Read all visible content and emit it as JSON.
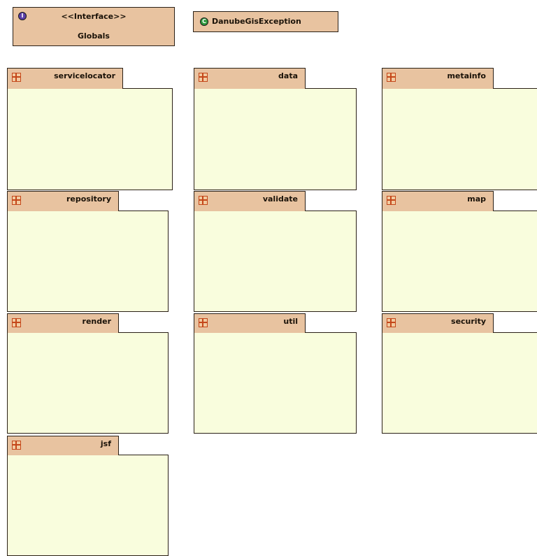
{
  "interface_class": {
    "icon": "interface-icon",
    "stereotype": "<<Interface>>",
    "name": "Globals"
  },
  "exception_class": {
    "icon": "class-icon",
    "name": "DanubeGisException"
  },
  "packages": [
    {
      "name": "servicelocator",
      "icon": "package-icon"
    },
    {
      "name": "data",
      "icon": "package-icon"
    },
    {
      "name": "metainfo",
      "icon": "package-icon"
    },
    {
      "name": "repository",
      "icon": "package-icon"
    },
    {
      "name": "validate",
      "icon": "package-icon"
    },
    {
      "name": "map",
      "icon": "package-icon"
    },
    {
      "name": "render",
      "icon": "package-icon"
    },
    {
      "name": "util",
      "icon": "package-icon"
    },
    {
      "name": "security",
      "icon": "package-icon"
    },
    {
      "name": "jsf",
      "icon": "package-icon"
    }
  ],
  "colors": {
    "class_fill": "#e8c3a0",
    "package_body": "#f9fddd",
    "interface_icon": "#5b3fa8",
    "class_icon": "#2f9a3e",
    "package_icon": "#c4471a"
  }
}
